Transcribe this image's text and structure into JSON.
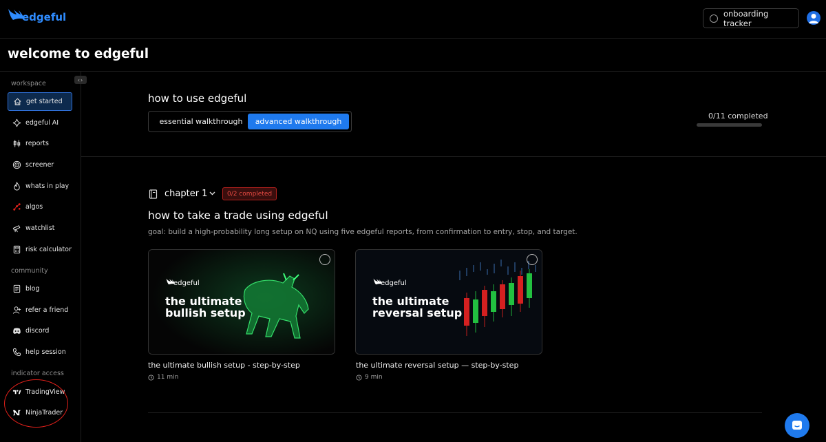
{
  "app": {
    "logo_text": "edgeful",
    "page_title": "welcome to edgeful"
  },
  "header": {
    "tracker_label": "onboarding tracker"
  },
  "sidebar": {
    "sections": [
      {
        "label": "workspace",
        "items": [
          {
            "label": "get started",
            "icon": "home-icon",
            "active": true
          },
          {
            "label": "edgeful AI",
            "icon": "sparkle-icon"
          },
          {
            "label": "reports",
            "icon": "candlestick-icon"
          },
          {
            "label": "screener",
            "icon": "target-icon"
          },
          {
            "label": "whats in play",
            "icon": "flame-icon"
          },
          {
            "label": "algos",
            "icon": "network-icon"
          },
          {
            "label": "watchlist",
            "icon": "telescope-icon"
          },
          {
            "label": "risk calculator",
            "icon": "calculator-icon"
          }
        ]
      },
      {
        "label": "community",
        "items": [
          {
            "label": "blog",
            "icon": "document-icon"
          },
          {
            "label": "refer a friend",
            "icon": "user-plus-icon"
          },
          {
            "label": "discord",
            "icon": "discord-icon"
          },
          {
            "label": "help session",
            "icon": "phone-icon"
          }
        ]
      },
      {
        "label": "indicator access",
        "items": [
          {
            "label": "TradingView",
            "icon": "tradingview-icon"
          },
          {
            "label": "NinjaTrader",
            "icon": "ninjatrader-icon"
          }
        ]
      }
    ]
  },
  "howto": {
    "title": "how to use edgeful",
    "tabs": [
      {
        "label": "essential walkthrough",
        "selected": false
      },
      {
        "label": "advanced walkthrough",
        "selected": true
      }
    ],
    "progress_text": "0/11 completed",
    "progress_fraction": 0
  },
  "chapter": {
    "label": "chapter 1",
    "badge": "0/2 completed",
    "title": "how to take a trade using edgeful",
    "goal": "goal: build a high-probability long setup on NQ using five edgeful reports, from confirmation to entry, stop, and target.",
    "cards": [
      {
        "thumb_logo": "edgeful",
        "thumb_title_1": "the ultimate",
        "thumb_title_2": "bullish setup",
        "caption": "the ultimate bullish setup - step-by-step",
        "duration": "11 min"
      },
      {
        "thumb_logo": "edgeful",
        "thumb_title_1": "the ultimate",
        "thumb_title_2": "reversal setup",
        "caption": "the ultimate reversal setup — step-by-step",
        "duration": "9 min"
      }
    ]
  },
  "colors": {
    "accent": "#1f7aee",
    "danger": "#e84b43",
    "background": "#000000"
  }
}
